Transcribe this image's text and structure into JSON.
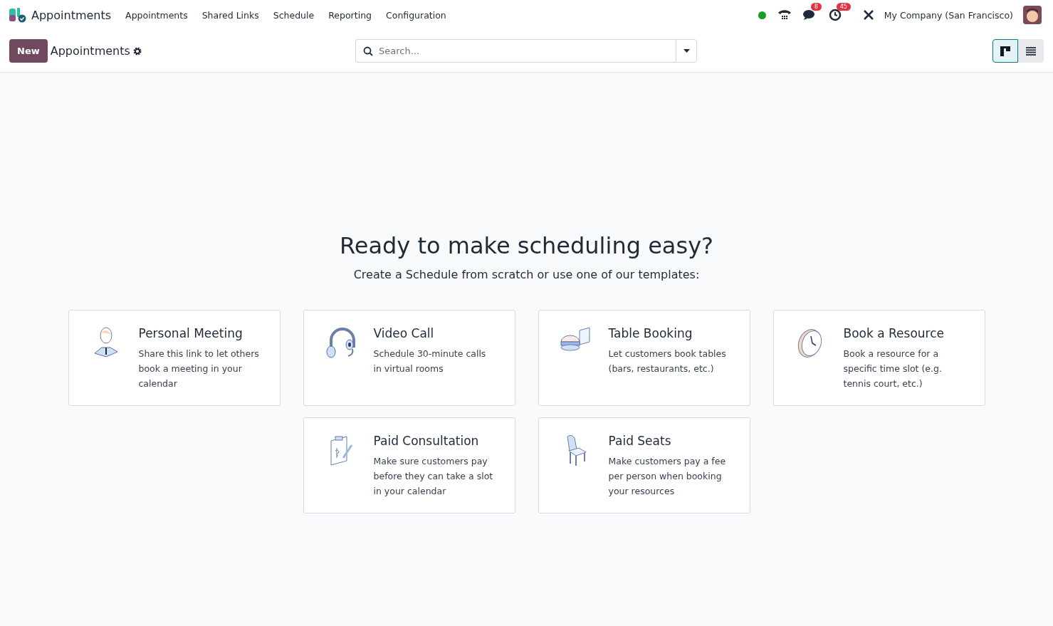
{
  "navbar": {
    "app_name": "Appointments",
    "menu": [
      "Appointments",
      "Shared Links",
      "Schedule",
      "Reporting",
      "Configuration"
    ],
    "messages_count": "8",
    "activities_count": "45",
    "company": "My Company (San Francisco)"
  },
  "control_panel": {
    "new_button": "New",
    "breadcrumb": "Appointments",
    "search": {
      "placeholder": "Search..."
    },
    "views": [
      {
        "kind": "kanban",
        "selected": true
      },
      {
        "kind": "list",
        "selected": false
      }
    ]
  },
  "helper": {
    "title": "Ready to make scheduling easy?",
    "subtitle": "Create a Schedule from scratch or use one of our templates:"
  },
  "templates": [
    {
      "kind": "person",
      "title": "Personal Meeting",
      "description": "Share this link to let others book a meeting in your calendar"
    },
    {
      "kind": "headset",
      "title": "Video Call",
      "description": "Schedule 30-minute calls in virtual rooms"
    },
    {
      "kind": "burger",
      "title": "Table Booking",
      "description": "Let customers book tables (bars, restaurants, etc.)"
    },
    {
      "kind": "clock",
      "title": "Book a Resource",
      "description": "Book a resource for a specific time slot (e.g. tennis court, etc.)"
    },
    {
      "kind": "clipboard",
      "title": "Paid Consultation",
      "description": "Make sure customers pay before they can take a slot in your calendar"
    },
    {
      "kind": "chair",
      "title": "Paid Seats",
      "description": "Make customers pay a fee per person when booking your resources"
    }
  ]
}
